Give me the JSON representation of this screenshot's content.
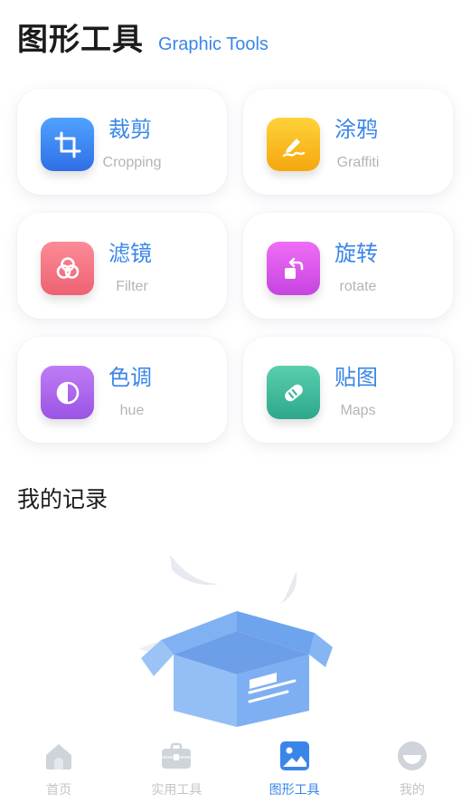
{
  "header": {
    "title": "图形工具",
    "subtitle": "Graphic Tools"
  },
  "tools": [
    {
      "cn": "裁剪",
      "en": "Cropping",
      "icon": "crop-icon",
      "color": "#3b7ff2"
    },
    {
      "cn": "涂鸦",
      "en": "Graffiti",
      "icon": "graffiti-pen-icon",
      "color": "#f7b81c"
    },
    {
      "cn": "滤镜",
      "en": "Filter",
      "icon": "filter-circles-icon",
      "color": "#f0737f"
    },
    {
      "cn": "旋转",
      "en": "rotate",
      "icon": "rotate-icon",
      "color": "#d04fe3"
    },
    {
      "cn": "色调",
      "en": "hue",
      "icon": "hue-contrast-icon",
      "color": "#a25ee8"
    },
    {
      "cn": "贴图",
      "en": "Maps",
      "icon": "sticker-icon",
      "color": "#36b89a"
    }
  ],
  "records": {
    "title": "我的记录"
  },
  "empty_state": {
    "icon": "empty-box-illustration"
  },
  "tabbar": [
    {
      "label": "首页",
      "icon": "home-icon",
      "active": false
    },
    {
      "label": "实用工具",
      "icon": "toolbox-icon",
      "active": false
    },
    {
      "label": "图形工具",
      "icon": "image-icon",
      "active": true
    },
    {
      "label": "我的",
      "icon": "profile-icon",
      "active": false
    }
  ],
  "colors": {
    "accent": "#3a86e8",
    "inactive": "#c4c4c4"
  }
}
